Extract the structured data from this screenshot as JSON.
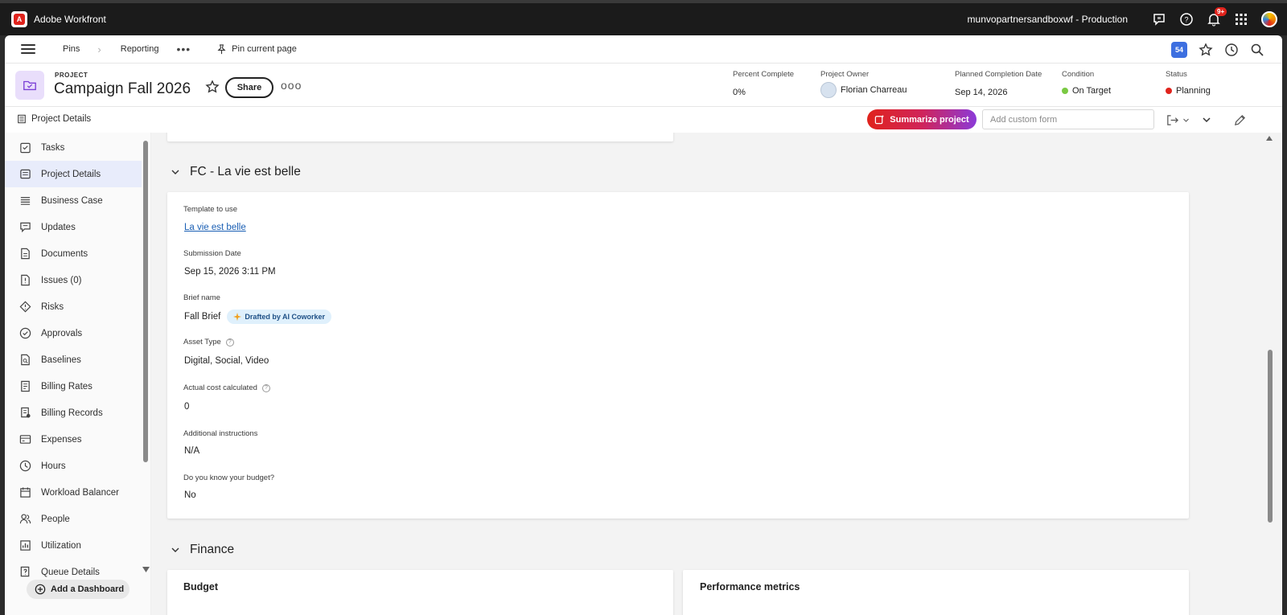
{
  "app": {
    "title": "Adobe Workfront",
    "logo_icon": "adobe-workfront-logo",
    "org": "munvopartnersandboxwf - Production",
    "notifications_badge": "9+"
  },
  "nav": {
    "pins": "Pins",
    "reporting": "Reporting",
    "more": "•••",
    "pin_current": "Pin current page",
    "count_badge": "54"
  },
  "project": {
    "label": "PROJECT",
    "title": "Campaign Fall 2026",
    "share": "Share",
    "more": "ooo",
    "meta": {
      "percent_label": "Percent Complete",
      "percent_value": "0%",
      "owner_label": "Project Owner",
      "owner_value": "Florian Charreau",
      "planned_label": "Planned Completion Date",
      "planned_value": "Sep 14, 2026",
      "condition_label": "Condition",
      "condition_value": "On Target",
      "condition_color": "#7ac943",
      "status_label": "Status",
      "status_value": "Planning",
      "status_color": "#e0231c"
    }
  },
  "subbar": {
    "title": "Project Details",
    "summarize": "Summarize project",
    "custom_form_placeholder": "Add custom form"
  },
  "sidebar": {
    "items": [
      {
        "label": "Tasks",
        "icon": "tasks-icon"
      },
      {
        "label": "Project Details",
        "icon": "details-icon"
      },
      {
        "label": "Business Case",
        "icon": "business-case-icon"
      },
      {
        "label": "Updates",
        "icon": "updates-icon"
      },
      {
        "label": "Documents",
        "icon": "documents-icon"
      },
      {
        "label": "Issues (0)",
        "icon": "issues-icon"
      },
      {
        "label": "Risks",
        "icon": "risks-icon"
      },
      {
        "label": "Approvals",
        "icon": "approvals-icon"
      },
      {
        "label": "Baselines",
        "icon": "baselines-icon"
      },
      {
        "label": "Billing Rates",
        "icon": "billing-rates-icon"
      },
      {
        "label": "Billing Records",
        "icon": "billing-records-icon"
      },
      {
        "label": "Expenses",
        "icon": "expenses-icon"
      },
      {
        "label": "Hours",
        "icon": "hours-icon"
      },
      {
        "label": "Workload Balancer",
        "icon": "workload-icon"
      },
      {
        "label": "People",
        "icon": "people-icon"
      },
      {
        "label": "Utilization",
        "icon": "utilization-icon"
      },
      {
        "label": "Queue Details",
        "icon": "queue-icon"
      }
    ],
    "add_dashboard": "Add a Dashboard"
  },
  "form_section": {
    "title": "FC - La vie est belle",
    "fields": {
      "template_label": "Template to use",
      "template_value": "La vie est belle",
      "submission_label": "Submission Date",
      "submission_value": "Sep 15, 2026 3:11 PM",
      "brief_label": "Brief name",
      "brief_value": "Fall Brief",
      "brief_badge": "Drafted by AI Coworker",
      "asset_label": "Asset Type",
      "asset_value": "Digital, Social, Video",
      "cost_label": "Actual cost calculated",
      "cost_value": "0",
      "instructions_label": "Additional instructions",
      "instructions_value": "N/A",
      "budget_q_label": "Do you know your budget?",
      "budget_q_value": "No"
    }
  },
  "finance_section": {
    "title": "Finance",
    "budget_title": "Budget",
    "metrics_title": "Performance metrics"
  }
}
